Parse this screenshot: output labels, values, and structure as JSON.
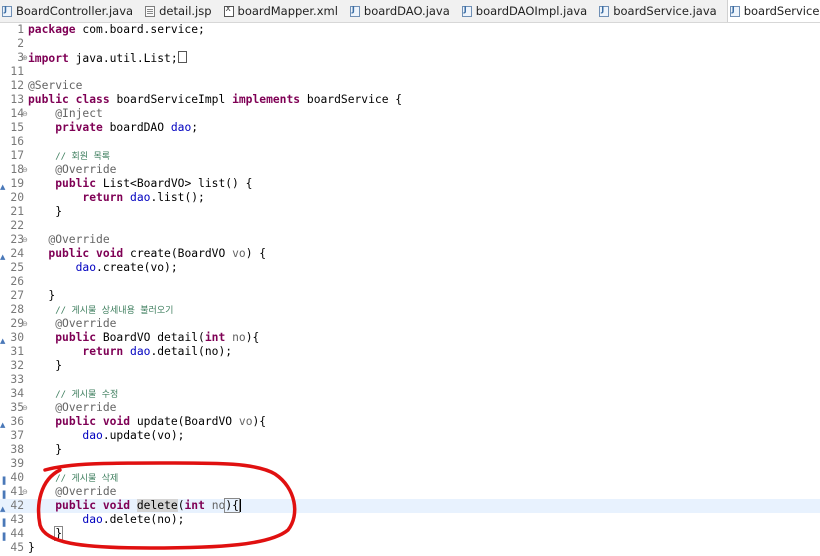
{
  "tabs": [
    {
      "label": "BoardController.java",
      "icon": "java-file-icon"
    },
    {
      "label": "detail.jsp",
      "icon": "jsp-file-icon"
    },
    {
      "label": "boardMapper.xml",
      "icon": "xml-file-icon"
    },
    {
      "label": "boardDAO.java",
      "icon": "java-file-icon"
    },
    {
      "label": "boardDAOImpl.java",
      "icon": "java-file-icon"
    },
    {
      "label": "boardService.java",
      "icon": "java-file-icon"
    },
    {
      "label": "boardServiceImpl.java",
      "icon": "java-file-icon",
      "active": true,
      "close": "✕"
    }
  ],
  "editor": {
    "lines": {
      "l1": {
        "num": "1",
        "t": [
          "package",
          " com.board.service;"
        ]
      },
      "l2": {
        "num": "2"
      },
      "l3": {
        "num": "3",
        "t": [
          "import",
          " java.util.List;"
        ]
      },
      "l11": {
        "num": "11"
      },
      "l12": {
        "num": "12",
        "t": [
          "@Service"
        ]
      },
      "l13": {
        "num": "13",
        "t": [
          "public",
          " ",
          "class",
          " boardServiceImpl ",
          "implements",
          " boardService {"
        ]
      },
      "l14": {
        "num": "14",
        "t": [
          "    ",
          "@Inject"
        ]
      },
      "l15": {
        "num": "15",
        "t": [
          "    ",
          "private",
          " boardDAO ",
          "dao",
          ";"
        ]
      },
      "l16": {
        "num": "16"
      },
      "l17": {
        "num": "17",
        "t": [
          "    ",
          "// 회원 목록"
        ]
      },
      "l18": {
        "num": "18",
        "t": [
          "    ",
          "@Override"
        ]
      },
      "l19": {
        "num": "19",
        "t": [
          "    ",
          "public",
          " List<BoardVO> list() {"
        ]
      },
      "l20": {
        "num": "20",
        "t": [
          "        ",
          "return",
          " ",
          "dao",
          ".list();"
        ]
      },
      "l21": {
        "num": "21",
        "t": [
          "    }"
        ]
      },
      "l22": {
        "num": "22"
      },
      "l23": {
        "num": "23",
        "t": [
          "   ",
          "@Override"
        ]
      },
      "l24": {
        "num": "24",
        "t": [
          "   ",
          "public",
          " ",
          "void",
          " create(BoardVO ",
          "vo",
          ") {"
        ]
      },
      "l25": {
        "num": "25",
        "t": [
          "       ",
          "dao",
          ".create(",
          "vo",
          ");"
        ]
      },
      "l26": {
        "num": "26"
      },
      "l27": {
        "num": "27",
        "t": [
          "   }"
        ]
      },
      "l28": {
        "num": "28",
        "t": [
          "    ",
          "// 게시물 상세내용 불러오기"
        ]
      },
      "l29": {
        "num": "29",
        "t": [
          "    ",
          "@Override"
        ]
      },
      "l30": {
        "num": "30",
        "t": [
          "    ",
          "public",
          " BoardVO detail(",
          "int",
          " ",
          "no",
          "){"
        ]
      },
      "l31": {
        "num": "31",
        "t": [
          "        ",
          "return",
          " ",
          "dao",
          ".detail(",
          "no",
          ");"
        ]
      },
      "l32": {
        "num": "32",
        "t": [
          "    }"
        ]
      },
      "l33": {
        "num": "33"
      },
      "l34": {
        "num": "34",
        "t": [
          "    ",
          "// 게시물 수정"
        ]
      },
      "l35": {
        "num": "35",
        "t": [
          "    ",
          "@Override"
        ]
      },
      "l36": {
        "num": "36",
        "t": [
          "    ",
          "public",
          " ",
          "void",
          " update(BoardVO ",
          "vo",
          "){"
        ]
      },
      "l37": {
        "num": "37",
        "t": [
          "        ",
          "dao",
          ".update(",
          "vo",
          ");"
        ]
      },
      "l38": {
        "num": "38",
        "t": [
          "    }"
        ]
      },
      "l39": {
        "num": "39"
      },
      "l40": {
        "num": "40",
        "t": [
          "    ",
          "// 게시물 삭제"
        ]
      },
      "l41": {
        "num": "41",
        "t": [
          "    ",
          "@Override"
        ]
      },
      "l42": {
        "num": "42",
        "t": [
          "    ",
          "public",
          " ",
          "void",
          " ",
          "delete",
          "(",
          "int",
          " ",
          "no",
          "){"
        ]
      },
      "l43": {
        "num": "43",
        "t": [
          "        ",
          "dao",
          ".delete(",
          "no",
          ");"
        ]
      },
      "l44": {
        "num": "44",
        "t": [
          "    ",
          "}"
        ]
      },
      "l45": {
        "num": "45",
        "t": [
          "}"
        ]
      }
    }
  },
  "colors": {
    "keyword": "#7f0055",
    "annotation": "#646464",
    "comment": "#3f7f5f",
    "field": "#0000c0",
    "current_line": "#e8f2fe",
    "red_circle": "#e01010"
  }
}
